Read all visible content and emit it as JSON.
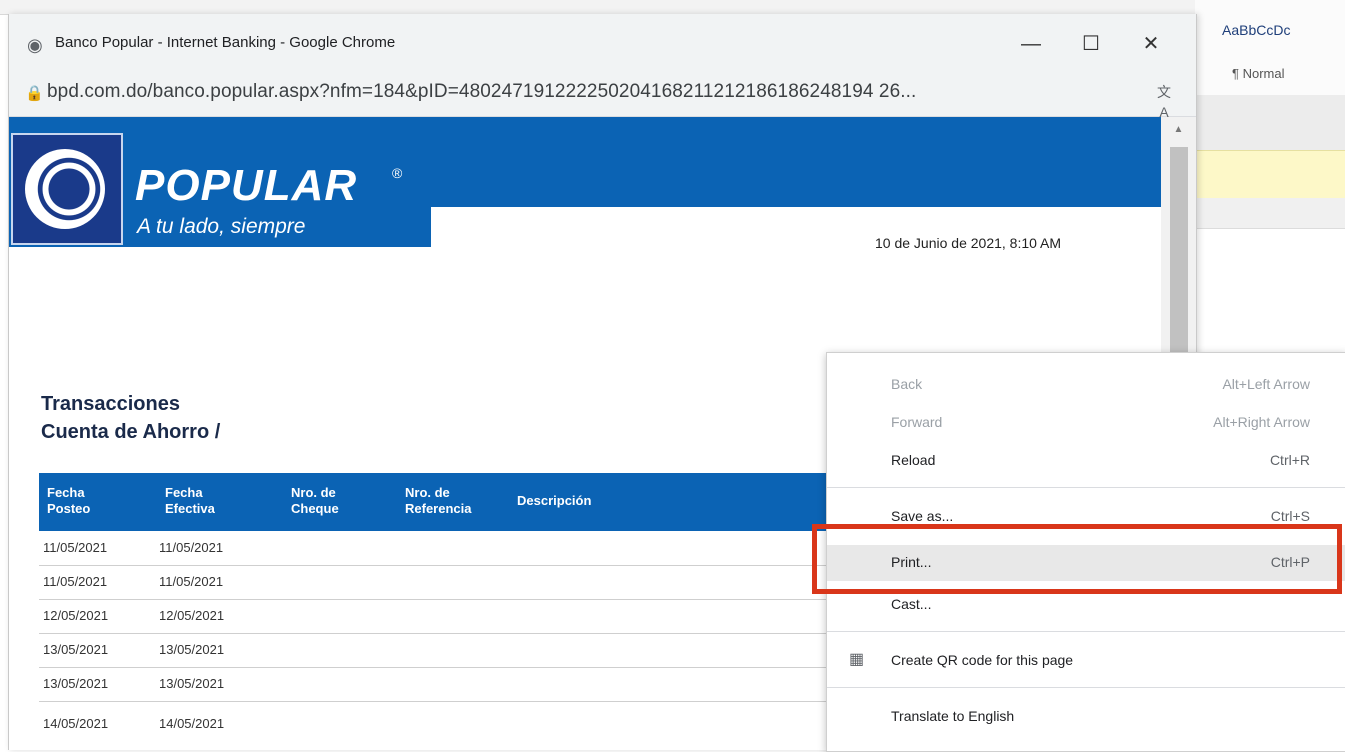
{
  "background_app": {
    "style_sample": "AaBbCcDc",
    "style_name": "¶ Normal"
  },
  "window": {
    "title": "Banco Popular - Internet Banking - Google Chrome",
    "minimize": "—",
    "maximize": "☐",
    "close": "✕",
    "url": "bpd.com.do/banco.popular.aspx?nfm=184&pID=480247191222250204168211212186186248194 26..."
  },
  "bank": {
    "brand": "POPULAR",
    "registered": "®",
    "slogan": "A tu lado, siempre",
    "date": "10 de Junio de 2021, 8:10 AM"
  },
  "transactions": {
    "title": "Transacciones",
    "subtitle": "Cuenta de Ahorro /",
    "headers": {
      "posting_date": [
        "Fecha",
        "Posteo"
      ],
      "effective_date": [
        "Fecha",
        "Efectiva"
      ],
      "check_number": [
        "Nro. de",
        "Cheque"
      ],
      "reference_number": [
        "Nro. de",
        "Referencia"
      ],
      "description": "Descripción"
    },
    "rows": [
      {
        "posteo": "11/05/2021",
        "efectiva": "11/05/2021"
      },
      {
        "posteo": "11/05/2021",
        "efectiva": "11/05/2021"
      },
      {
        "posteo": "12/05/2021",
        "efectiva": "12/05/2021"
      },
      {
        "posteo": "13/05/2021",
        "efectiva": "13/05/2021"
      },
      {
        "posteo": "13/05/2021",
        "efectiva": "13/05/2021"
      },
      {
        "posteo": "14/05/2021",
        "efectiva": "14/05/2021"
      }
    ]
  },
  "context_menu": {
    "back": {
      "label": "Back",
      "shortcut": "Alt+Left Arrow"
    },
    "forward": {
      "label": "Forward",
      "shortcut": "Alt+Right Arrow"
    },
    "reload": {
      "label": "Reload",
      "shortcut": "Ctrl+R"
    },
    "save_as": {
      "label": "Save as...",
      "shortcut": "Ctrl+S"
    },
    "print": {
      "label": "Print...",
      "shortcut": "Ctrl+P"
    },
    "cast": {
      "label": "Cast..."
    },
    "qr": {
      "label": "Create QR code for this page"
    },
    "translate": {
      "label": "Translate to English"
    }
  },
  "colors": {
    "brand_blue": "#0b63b4",
    "highlight": "#d9361a"
  }
}
